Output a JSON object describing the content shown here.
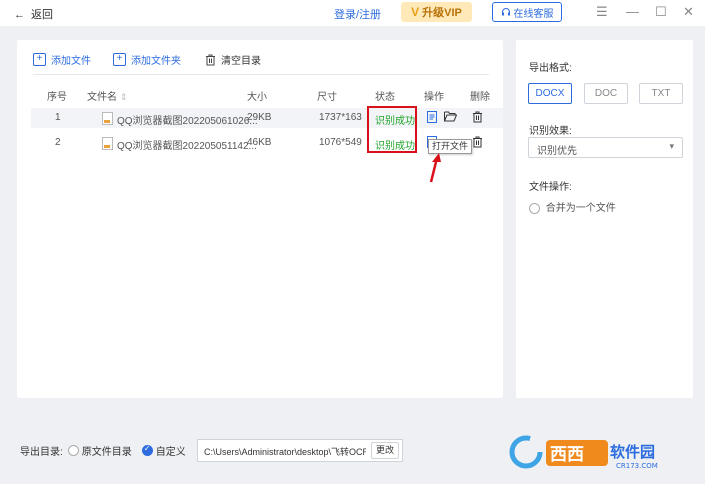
{
  "header": {
    "back_label": "返回",
    "login_label": "登录/注册",
    "vip_label": "升级VIP",
    "vip_mark": "V",
    "service_label": "在线客服",
    "service_icon": "headset-icon",
    "menu_icon": "menu-icon",
    "minimize_icon": "minimize-icon",
    "maximize_icon": "maximize-icon",
    "close_icon": "close-icon"
  },
  "toolbar": {
    "add_file": "添加文件",
    "add_folder": "添加文件夹",
    "clear_list": "清空目录"
  },
  "table": {
    "columns": [
      "序号",
      "文件名",
      "大小",
      "尺寸",
      "状态",
      "操作",
      "删除"
    ],
    "sort_mark": "⇕",
    "rows": [
      {
        "index": "1",
        "name": "QQ浏览器截图202205061026...",
        "size": "29KB",
        "dims": "1737*163",
        "status": "识别成功"
      },
      {
        "index": "2",
        "name": "QQ浏览器截图202205051142...",
        "size": "46KB",
        "dims": "1076*549",
        "status": "识别成功"
      }
    ],
    "tooltip": "打开文件"
  },
  "settings": {
    "export_format_label": "导出格式:",
    "formats": [
      "DOCX",
      "DOC",
      "TXT"
    ],
    "selected_format": "DOCX",
    "recognition_label": "识别效果:",
    "recognition_value": "识别优先",
    "file_ops_label": "文件操作:",
    "merge_label": "合并为一个文件"
  },
  "footer": {
    "output_dir_label": "导出目录:",
    "option_original": "原文件目录",
    "option_custom": "自定义",
    "path": "C:\\Users\\Administrator\\desktop\\飞转OCR\\",
    "change_label": "更改"
  },
  "watermark": {
    "brand": "西西软件园",
    "domain": "CR173.COM"
  },
  "colors": {
    "accent": "#2d6cdf",
    "success": "#21a52b",
    "highlight_red": "#d90f1a",
    "vip_bg": "#ffe9b8"
  }
}
